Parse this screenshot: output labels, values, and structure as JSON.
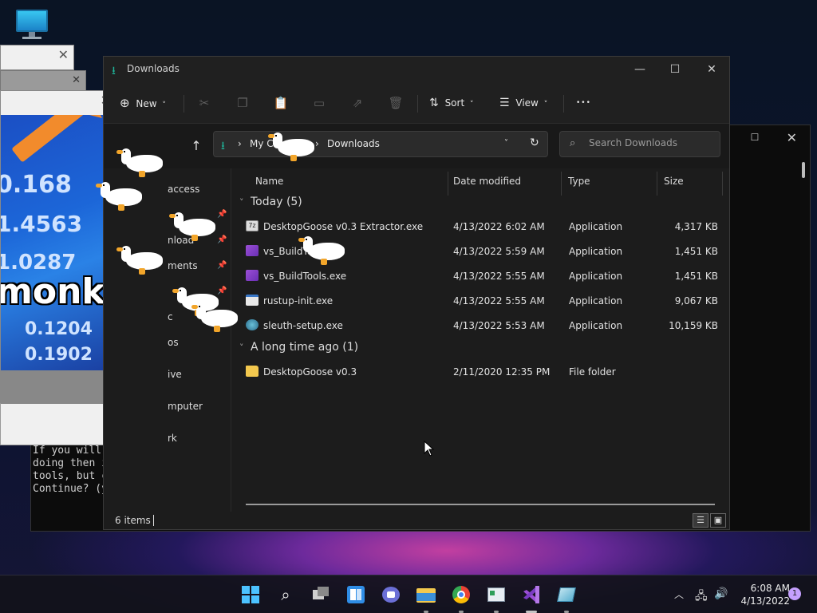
{
  "terminal": {
    "lines": [
      "If you will",
      "doing then i",
      "tools, but c",
      "",
      "Continue? (y"
    ]
  },
  "meme": {
    "numbers": [
      "0.168",
      "1.4563",
      "1.0287",
      "0.1204",
      "0.1902"
    ],
    "caption": "monks"
  },
  "explorer": {
    "title": "Downloads",
    "toolbar": {
      "new_label": "New",
      "sort_label": "Sort",
      "view_label": "View",
      "more_label": "•••"
    },
    "breadcrumb": {
      "root": "My Co",
      "current": "Downloads"
    },
    "search": {
      "placeholder": "Search Downloads"
    },
    "nav_items": [
      "access",
      "nload",
      "ments",
      "c",
      "os",
      "ive",
      "mputer",
      "rk"
    ],
    "columns": [
      "Name",
      "Date modified",
      "Type",
      "Size"
    ],
    "groups": [
      {
        "label": "Today (5)",
        "files": [
          {
            "name": "DesktopGoose v0.3 Extractor.exe",
            "date": "4/13/2022 6:02 AM",
            "type": "Application",
            "size": "4,317 KB",
            "icon": "extractor-icon"
          },
          {
            "name": "vs_BuildToo",
            "name_suffix": "e",
            "date": "4/13/2022 5:59 AM",
            "type": "Application",
            "size": "1,451 KB",
            "icon": "visual-studio-icon"
          },
          {
            "name": "vs_BuildTools.exe",
            "date": "4/13/2022 5:55 AM",
            "type": "Application",
            "size": "1,451 KB",
            "icon": "visual-studio-icon"
          },
          {
            "name": "rustup-init.exe",
            "date": "4/13/2022 5:55 AM",
            "type": "Application",
            "size": "9,067 KB",
            "icon": "app-window-icon"
          },
          {
            "name": "sleuth-setup.exe",
            "date": "4/13/2022 5:53 AM",
            "type": "Application",
            "size": "10,159 KB",
            "icon": "sleuth-icon"
          }
        ]
      },
      {
        "label": "A long time ago (1)",
        "files": [
          {
            "name": "DesktopGoose v0.3",
            "date": "2/11/2020 12:35 PM",
            "type": "File folder",
            "size": "",
            "icon": "folder-icon"
          }
        ]
      }
    ],
    "status": {
      "items_count": "6 items"
    }
  },
  "taskbar": {
    "clock_time": "6:08 AM",
    "clock_date": "4/13/2022",
    "notification_count": "1"
  },
  "colors": {
    "accent_teal": "#1fb59a",
    "explorer_bg": "#1c1c1c",
    "goose_beak": "#f2a52a"
  }
}
